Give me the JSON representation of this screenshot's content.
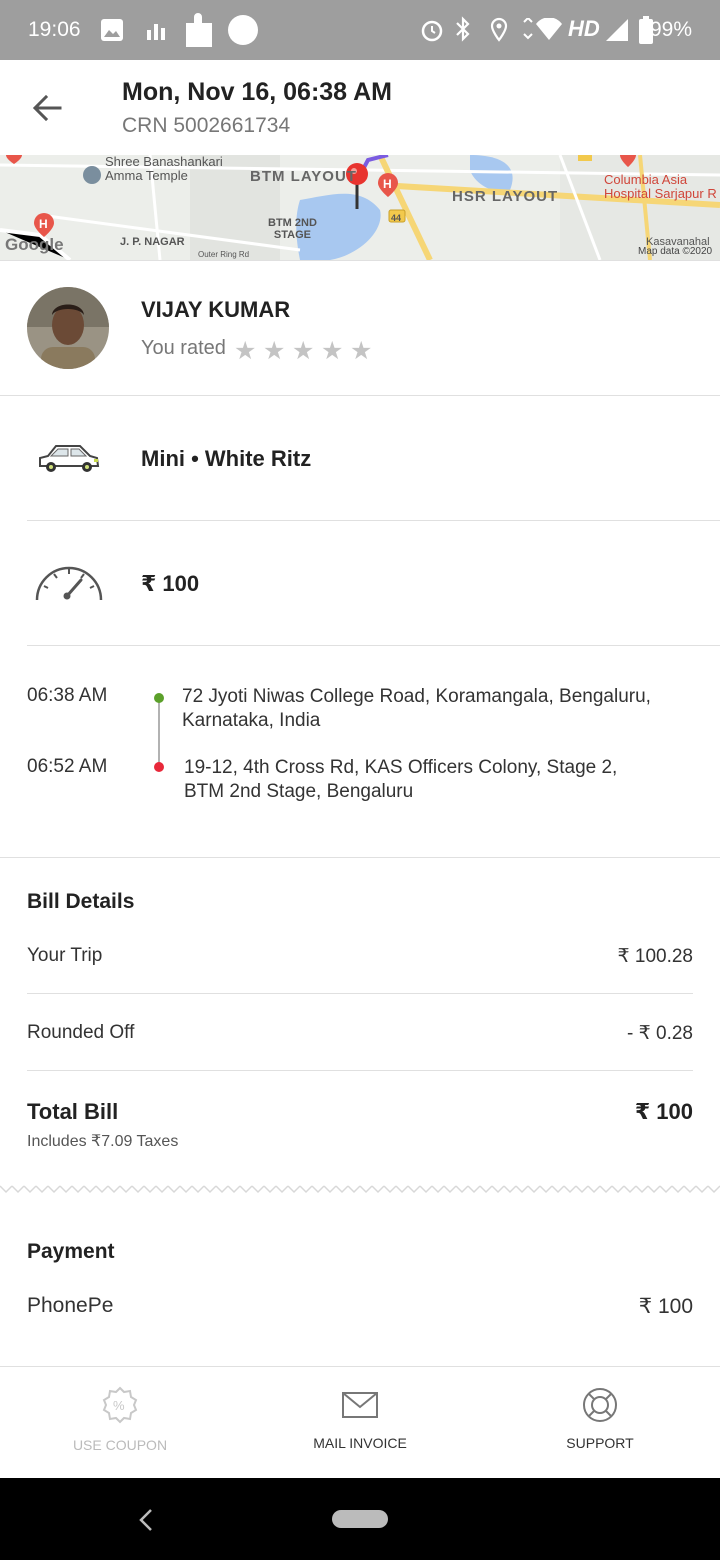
{
  "status_bar": {
    "time": "19:06",
    "network": "HD",
    "battery": "99%"
  },
  "header": {
    "title": "Mon, Nov 16, 06:38 AM",
    "crn": "CRN 5002661734"
  },
  "map": {
    "labels": {
      "banashankari": "Shree Banashankari\nAmma Temple",
      "btm_layout": "BTM LAYOUT",
      "btm_2nd": "BTM 2ND\nSTAGE",
      "hsr_layout": "HSR LAYOUT",
      "columbia": "Columbia Asia\nHospital Sarjapur R",
      "jp_nagar": "J. P. NAGAR",
      "kasavanahalli": "Kasavanahal",
      "outer_ring": "Outer Ring Rd",
      "road_44": "44",
      "google": "Google",
      "map_data": "Map data ©2020"
    }
  },
  "driver": {
    "name": "VIJAY KUMAR",
    "rated_label": "You rated",
    "rating_stars": 0
  },
  "vehicle": {
    "text": "Mini • White Ritz"
  },
  "fare": {
    "amount": "₹ 100"
  },
  "trip": {
    "pickup_time": "06:38 AM",
    "pickup_address": "72 Jyoti Niwas College Road, Koramangala, Bengaluru, Karnataka, India",
    "drop_time": "06:52 AM",
    "drop_address": "19-12, 4th Cross Rd, KAS Officers Colony, Stage 2, BTM 2nd Stage, Bengaluru",
    "pickup_dot_color": "#5ba02a",
    "drop_dot_color": "#e8283a"
  },
  "bill": {
    "title": "Bill Details",
    "your_trip_label": "Your Trip",
    "your_trip_value": "₹ 100.28",
    "rounded_label": "Rounded Off",
    "rounded_value": "- ₹ 0.28",
    "total_label": "Total Bill",
    "total_value": "₹ 100",
    "taxes_note": "Includes ₹7.09 Taxes"
  },
  "payment": {
    "title": "Payment",
    "method": "PhonePe",
    "amount": "₹ 100"
  },
  "actions": {
    "use_coupon": "USE COUPON",
    "mail_invoice": "MAIL INVOICE",
    "support": "SUPPORT"
  }
}
